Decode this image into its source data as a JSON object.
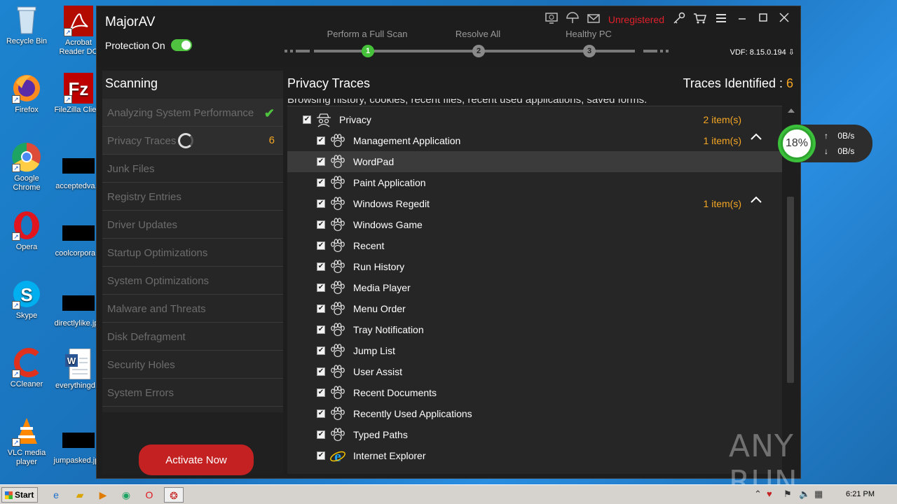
{
  "desktop": {
    "icons": [
      {
        "label": "Recycle Bin",
        "icon": "recycle-bin-icon"
      },
      {
        "label": "Acrobat Reader DC",
        "icon": "acrobat-icon"
      },
      {
        "label": "Firefox",
        "icon": "firefox-icon"
      },
      {
        "label": "FileZilla Client",
        "icon": "filezilla-icon"
      },
      {
        "label": "Google Chrome",
        "icon": "chrome-icon"
      },
      {
        "label": "acceptedva...",
        "icon": "file-icon"
      },
      {
        "label": "Opera",
        "icon": "opera-icon"
      },
      {
        "label": "coolcorpora...",
        "icon": "file-icon"
      },
      {
        "label": "Skype",
        "icon": "skype-icon"
      },
      {
        "label": "directlylike.jpg",
        "icon": "file-icon"
      },
      {
        "label": "CCleaner",
        "icon": "ccleaner-icon"
      },
      {
        "label": "everythingd...",
        "icon": "word-doc-icon"
      },
      {
        "label": "VLC media player",
        "icon": "vlc-icon"
      },
      {
        "label": "jumpasked.jpg",
        "icon": "file-icon"
      }
    ]
  },
  "app": {
    "name": "MajorAV",
    "protection_label": "Protection On",
    "unregistered": "Unregistered",
    "vdf": "VDF: 8.15.0.194",
    "steps": [
      {
        "label": "Perform a Full Scan",
        "num": "1"
      },
      {
        "label": "Resolve All",
        "num": "2"
      },
      {
        "label": "Healthy PC",
        "num": "3"
      }
    ],
    "left": {
      "title": "Scanning",
      "items": [
        "Analyzing System Performance",
        "Privacy Traces",
        "Junk Files",
        "Registry Entries",
        "Driver Updates",
        "Startup Optimizations",
        "System Optimizations",
        "Malware and Threats",
        "Disk Defragment",
        "Security Holes",
        "System Errors"
      ],
      "privacy_count": "6",
      "activate": "Activate Now"
    },
    "right": {
      "title": "Privacy Traces",
      "traces_label": "Traces Identified : ",
      "traces_count": "6",
      "description": "Browsing history, cookies, recent files, recent used applications, saved forms.",
      "rows": [
        {
          "label": "Privacy",
          "items": "2 item(s)"
        },
        {
          "label": "Management Application",
          "items": "1 item(s)"
        },
        {
          "label": "WordPad",
          "items": ""
        },
        {
          "label": "Paint Application",
          "items": ""
        },
        {
          "label": "Windows Regedit",
          "items": "1 item(s)"
        },
        {
          "label": "Windows Game",
          "items": ""
        },
        {
          "label": "Recent",
          "items": ""
        },
        {
          "label": "Run History",
          "items": ""
        },
        {
          "label": "Media Player",
          "items": ""
        },
        {
          "label": "Menu Order",
          "items": ""
        },
        {
          "label": "Tray Notification",
          "items": ""
        },
        {
          "label": "Jump List",
          "items": ""
        },
        {
          "label": "User Assist",
          "items": ""
        },
        {
          "label": "Recent Documents",
          "items": ""
        },
        {
          "label": "Recently Used Applications",
          "items": ""
        },
        {
          "label": "Typed Paths",
          "items": ""
        },
        {
          "label": "Internet Explorer",
          "items": ""
        }
      ]
    }
  },
  "widget": {
    "percent": "18%",
    "up": "0B/s",
    "down": "0B/s"
  },
  "watermark": "ANY RUN",
  "taskbar": {
    "start": "Start",
    "time": "6:21 PM"
  }
}
